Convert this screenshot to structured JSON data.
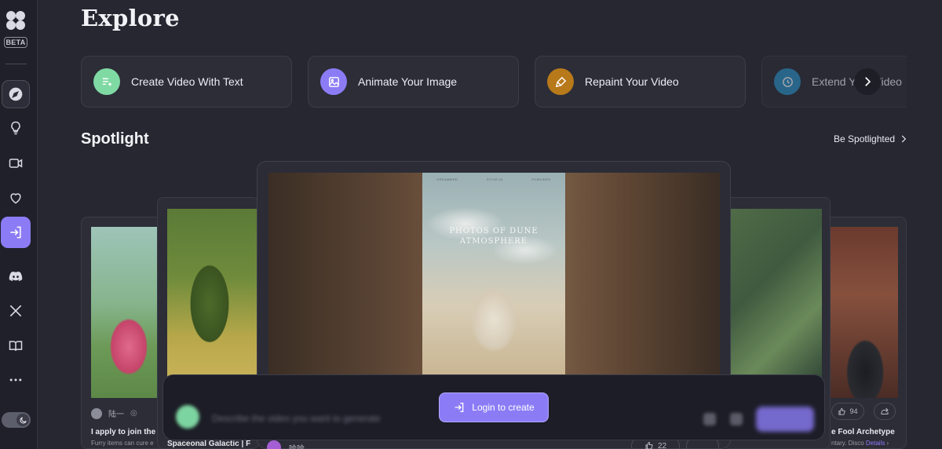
{
  "sidebar": {
    "beta_label": "BETA",
    "items": [
      {
        "name": "explore",
        "icon": "compass-icon"
      },
      {
        "name": "inspiration",
        "icon": "lightbulb-icon"
      },
      {
        "name": "videos",
        "icon": "video-camera-icon"
      },
      {
        "name": "favorites",
        "icon": "heart-icon"
      },
      {
        "name": "login",
        "icon": "login-icon"
      },
      {
        "name": "discord",
        "icon": "discord-icon"
      },
      {
        "name": "x",
        "icon": "x-logo-icon"
      },
      {
        "name": "docs",
        "icon": "book-icon"
      },
      {
        "name": "more",
        "icon": "more-horizontal-icon"
      }
    ]
  },
  "header": {
    "title": "Explore"
  },
  "features": [
    {
      "label": "Create Video With Text",
      "icon": "text-to-video-icon",
      "color": "#7fd9a3"
    },
    {
      "label": "Animate Your Image",
      "icon": "image-icon",
      "color": "#8b7cf6"
    },
    {
      "label": "Repaint Your Video",
      "icon": "brush-icon",
      "color": "#b8791a"
    },
    {
      "label": "Extend Your Video",
      "icon": "clock-icon",
      "color": "#2a8fc4"
    }
  ],
  "spotlight": {
    "title": "Spotlight",
    "cta": "Be Spotlighted",
    "cards": {
      "left": {
        "author": "陆一",
        "title": "I apply to join the",
        "desc": "Furry items can cure e"
      },
      "mid_left": {
        "title": "Spaceonal Galactic | F"
      },
      "center": {
        "poster_top": [
          "DREAMBIRD",
          "STYLE 24",
          "FILMVIDEO"
        ],
        "poster_title": "PHOTOS OF DUNE ATMOSPHERE",
        "author": "哈哈",
        "likes": "22"
      },
      "right": {
        "likes": "94",
        "title": "e Fool Archetype",
        "desc": "ntary. Disco",
        "details": "Details"
      }
    }
  },
  "prompt": {
    "placeholder": "Describe the video you want to generate",
    "login_label": "Login to create"
  },
  "colors": {
    "accent": "#8b7cf6",
    "bg": "#262731",
    "sidebar": "#1f2029"
  }
}
